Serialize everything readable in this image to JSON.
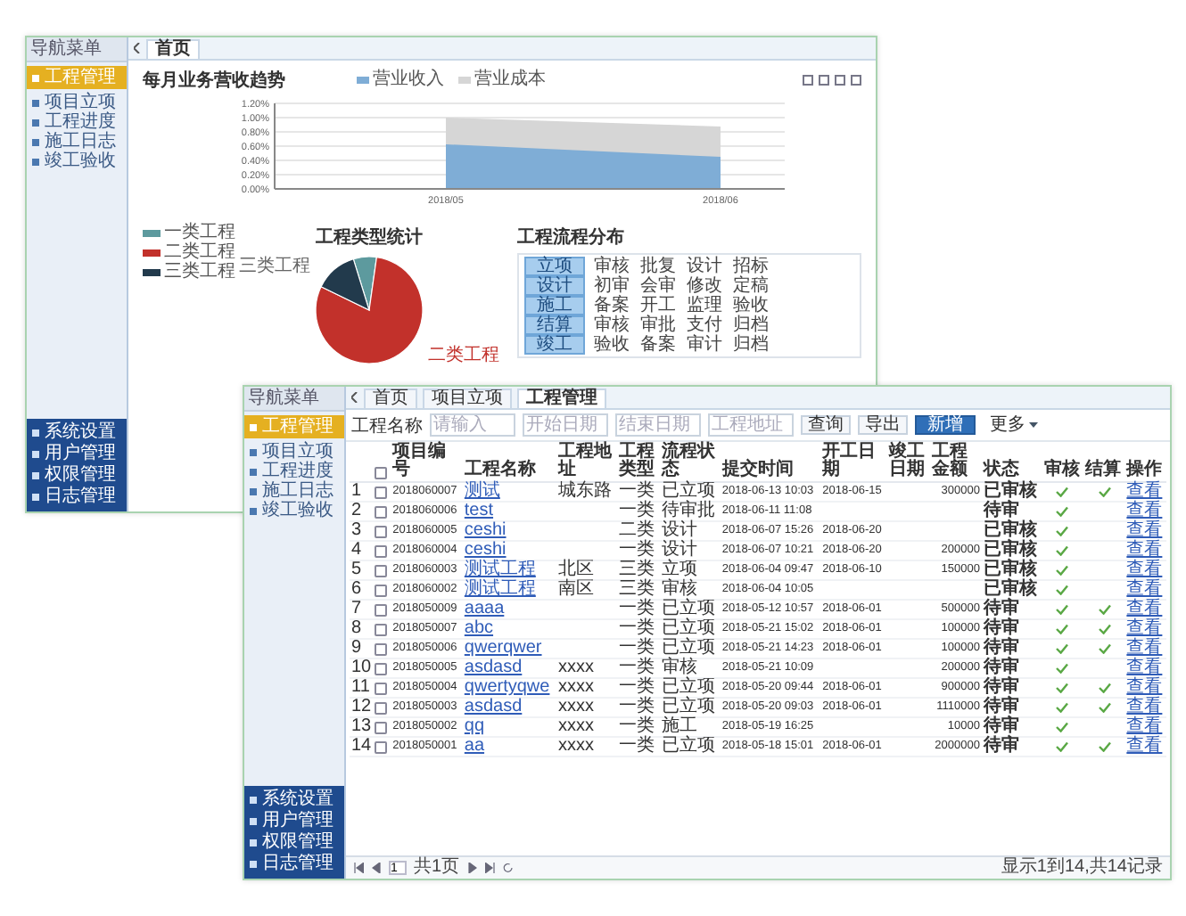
{
  "back_window": {
    "sidebar": {
      "title": "导航菜单",
      "items": [
        {
          "label": "工程管理",
          "selected": true
        },
        {
          "label": "项目立项",
          "selected": false
        },
        {
          "label": "工程进度",
          "selected": false
        },
        {
          "label": "施工日志",
          "selected": false
        },
        {
          "label": "竣工验收",
          "selected": false
        }
      ],
      "bottom_items": [
        {
          "label": "系统设置"
        },
        {
          "label": "用户管理"
        },
        {
          "label": "权限管理"
        },
        {
          "label": "日志管理"
        }
      ]
    },
    "tabs": [
      {
        "label": "首页",
        "selected": true
      }
    ],
    "trend": {
      "title": "每月业务营收趋势",
      "legend": [
        {
          "label": "营业收入",
          "color": "#7fadd6"
        },
        {
          "label": "营业成本",
          "color": "#d6d6d6"
        }
      ],
      "yticks": [
        "1.20%",
        "1.00%",
        "0.80%",
        "0.60%",
        "0.40%",
        "0.20%",
        "0.00%"
      ],
      "xlabels": [
        "2018/05",
        "2018/06"
      ]
    },
    "pie": {
      "title": "工程类型统计",
      "legend": [
        {
          "label": "一类工程",
          "color": "#5d9a9e"
        },
        {
          "label": "二类工程",
          "color": "#c2312b"
        },
        {
          "label": "三类工程",
          "color": "#223a4c"
        }
      ],
      "labels": [
        "三类工程",
        "二类工程"
      ]
    },
    "process": {
      "title": "工程流程分布",
      "rows": [
        {
          "label": "立项",
          "cells": [
            "审核",
            "批复",
            "设计",
            "招标"
          ]
        },
        {
          "label": "设计",
          "cells": [
            "初审",
            "会审",
            "修改",
            "定稿"
          ]
        },
        {
          "label": "施工",
          "cells": [
            "备案",
            "开工",
            "监理",
            "验收"
          ]
        },
        {
          "label": "结算",
          "cells": [
            "审核",
            "审批",
            "支付",
            "归档"
          ]
        },
        {
          "label": "竣工",
          "cells": [
            "验收",
            "备案",
            "审计",
            "归档"
          ]
        }
      ]
    }
  },
  "front_window": {
    "sidebar": {
      "title": "导航菜单",
      "items": [
        {
          "label": "工程管理",
          "selected": true
        },
        {
          "label": "项目立项",
          "selected": false
        },
        {
          "label": "工程进度",
          "selected": false
        },
        {
          "label": "施工日志",
          "selected": false
        },
        {
          "label": "竣工验收",
          "selected": false
        }
      ],
      "bottom_items": [
        {
          "label": "系统设置"
        },
        {
          "label": "用户管理"
        },
        {
          "label": "权限管理"
        },
        {
          "label": "日志管理"
        }
      ]
    },
    "tabs": [
      {
        "label": "首页",
        "selected": false
      },
      {
        "label": "项目立项",
        "selected": false
      },
      {
        "label": "工程管理",
        "selected": true
      }
    ],
    "toolbar": {
      "label": "工程名称",
      "fields": [
        {
          "placeholder": "请输入"
        },
        {
          "placeholder": "开始日期"
        },
        {
          "placeholder": "结束日期"
        },
        {
          "placeholder": "工程地址"
        }
      ],
      "buttons": [
        {
          "label": "查询",
          "kind": "plain"
        },
        {
          "label": "导出",
          "kind": "plain"
        },
        {
          "label": "新增",
          "kind": "primary"
        },
        {
          "label": "更多",
          "kind": "dropdown"
        }
      ]
    },
    "all_checked": false,
    "columns": [
      "项目编号",
      "工程名称",
      "工程地址",
      "工程类型",
      "流程状态",
      "提交时间",
      "开工日期",
      "竣工日期",
      "工程金额",
      "状态",
      "审核",
      "结算",
      "操作"
    ],
    "rows": [
      {
        "no": "1",
        "checked": false,
        "code": "2018060007",
        "name": "测试",
        "address": "城东路",
        "type": "一类",
        "flow": "已立项",
        "submitted": "2018-06-13 10:03",
        "start": "2018-06-15",
        "amount": "300000",
        "status": "已审核",
        "audited": true,
        "settled": true,
        "action": "查看"
      },
      {
        "no": "2",
        "checked": false,
        "code": "2018060006",
        "name": "test",
        "type": "一类",
        "flow": "待审批",
        "submitted": "2018-06-11 11:08",
        "status": "待审",
        "audited": true,
        "settled": false,
        "action": "查看"
      },
      {
        "no": "3",
        "checked": false,
        "code": "2018060005",
        "name": "ceshi",
        "type": "二类",
        "flow": "设计",
        "submitted": "2018-06-07 15:26",
        "start": "2018-06-20",
        "status": "已审核",
        "audited": true,
        "settled": false,
        "action": "查看"
      },
      {
        "no": "4",
        "checked": false,
        "code": "2018060004",
        "name": "ceshi",
        "type": "一类",
        "flow": "设计",
        "submitted": "2018-06-07 10:21",
        "start": "2018-06-20",
        "amount": "200000",
        "status": "已审核",
        "audited": true,
        "settled": false,
        "action": "查看"
      },
      {
        "no": "5",
        "checked": false,
        "code": "2018060003",
        "name": "测试工程",
        "address": "北区",
        "type": "三类",
        "flow": "立项",
        "submitted": "2018-06-04 09:47",
        "start": "2018-06-10",
        "amount": "150000",
        "status": "已审核",
        "audited": true,
        "settled": false,
        "action": "查看"
      },
      {
        "no": "6",
        "checked": false,
        "code": "2018060002",
        "name": "测试工程",
        "address": "南区",
        "type": "三类",
        "flow": "审核",
        "submitted": "2018-06-04 10:05",
        "status": "已审核",
        "audited": true,
        "settled": false,
        "action": "查看"
      },
      {
        "no": "7",
        "checked": false,
        "code": "2018050009",
        "name": "aaaa",
        "type": "一类",
        "flow": "已立项",
        "submitted": "2018-05-12 10:57",
        "start": "2018-06-01",
        "amount": "500000",
        "status": "待审",
        "audited": true,
        "settled": true,
        "action": "查看"
      },
      {
        "no": "8",
        "checked": false,
        "code": "2018050007",
        "name": "abc",
        "type": "一类",
        "flow": "已立项",
        "submitted": "2018-05-21 15:02",
        "start": "2018-06-01",
        "amount": "100000",
        "status": "待审",
        "audited": true,
        "settled": true,
        "action": "查看"
      },
      {
        "no": "9",
        "checked": false,
        "code": "2018050006",
        "name": "qwerqwer",
        "type": "一类",
        "flow": "已立项",
        "submitted": "2018-05-21 14:23",
        "start": "2018-06-01",
        "amount": "100000",
        "status": "待审",
        "audited": true,
        "settled": true,
        "action": "查看"
      },
      {
        "no": "10",
        "checked": false,
        "code": "2018050005",
        "name": "asdasd",
        "address": "xxxx",
        "type": "一类",
        "flow": "审核",
        "submitted": "2018-05-21 10:09",
        "amount": "200000",
        "status": "待审",
        "audited": true,
        "settled": false,
        "action": "查看"
      },
      {
        "no": "11",
        "checked": false,
        "code": "2018050004",
        "name": "qwertyqwe",
        "address": "xxxx",
        "type": "一类",
        "flow": "已立项",
        "submitted": "2018-05-20 09:44",
        "start": "2018-06-01",
        "amount": "900000",
        "status": "待审",
        "audited": true,
        "settled": true,
        "action": "查看"
      },
      {
        "no": "12",
        "checked": false,
        "code": "2018050003",
        "name": "asdasd",
        "address": "xxxx",
        "type": "一类",
        "flow": "已立项",
        "submitted": "2018-05-20 09:03",
        "start": "2018-06-01",
        "amount": "1110000",
        "status": "待审",
        "audited": true,
        "settled": true,
        "action": "查看"
      },
      {
        "no": "13",
        "checked": false,
        "code": "2018050002",
        "name": "qq",
        "address": "xxxx",
        "type": "一类",
        "flow": "施工",
        "submitted": "2018-05-19 16:25",
        "amount": "10000",
        "status": "待审",
        "audited": true,
        "settled": false,
        "action": "查看"
      },
      {
        "no": "14",
        "checked": false,
        "code": "2018050001",
        "name": "aa",
        "address": "xxxx",
        "type": "一类",
        "flow": "已立项",
        "submitted": "2018-05-18 15:01",
        "start": "2018-06-01",
        "amount": "2000000",
        "status": "待审",
        "audited": true,
        "settled": true,
        "action": "查看"
      }
    ],
    "pager": {
      "page": "1",
      "total_pages": "共1页",
      "summary": "显示1到14,共14记录"
    }
  }
}
